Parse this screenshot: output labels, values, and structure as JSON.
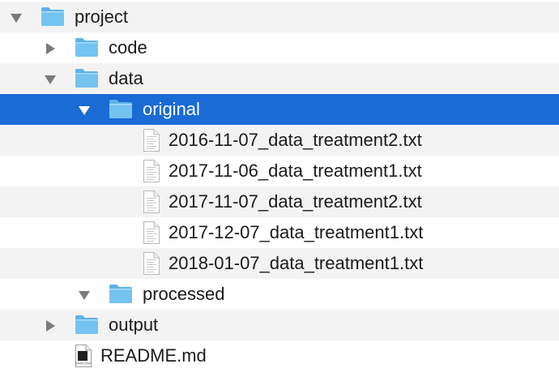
{
  "tree": [
    {
      "label": "project",
      "kind": "folder",
      "level": 0,
      "expanded": true,
      "icon": "folder-icon",
      "stripe": true
    },
    {
      "label": "code",
      "kind": "folder",
      "level": 1,
      "expanded": false,
      "icon": "folder-icon",
      "stripe": false
    },
    {
      "label": "data",
      "kind": "folder",
      "level": 1,
      "expanded": true,
      "icon": "folder-icon",
      "stripe": true
    },
    {
      "label": "original",
      "kind": "folder",
      "level": 2,
      "expanded": true,
      "icon": "folder-icon",
      "selected": true
    },
    {
      "label": "2016-11-07_data_treatment2.txt",
      "kind": "file",
      "level": 3,
      "icon": "text-file-icon",
      "stripe": true
    },
    {
      "label": "2017-11-06_data_treatment1.txt",
      "kind": "file",
      "level": 3,
      "icon": "text-file-icon",
      "stripe": false
    },
    {
      "label": "2017-11-07_data_treatment2.txt",
      "kind": "file",
      "level": 3,
      "icon": "text-file-icon",
      "stripe": true
    },
    {
      "label": "2017-12-07_data_treatment1.txt",
      "kind": "file",
      "level": 3,
      "icon": "text-file-icon",
      "stripe": false
    },
    {
      "label": "2018-01-07_data_treatment1.txt",
      "kind": "file",
      "level": 3,
      "icon": "text-file-icon",
      "stripe": true
    },
    {
      "label": "processed",
      "kind": "folder",
      "level": 2,
      "expanded": true,
      "icon": "folder-icon",
      "stripe": false
    },
    {
      "label": "output",
      "kind": "folder",
      "level": 1,
      "expanded": false,
      "icon": "folder-icon",
      "stripe": true
    },
    {
      "label": "README.md",
      "kind": "markdown",
      "level": 1,
      "icon": "markdown-file-icon",
      "badge": "MARKDOWN",
      "stripe": false
    }
  ],
  "colors": {
    "selection": "#1a6bd4",
    "stripe": "#f3f3f3",
    "folder": "#74c3f0",
    "text": "#1b1b1b"
  }
}
